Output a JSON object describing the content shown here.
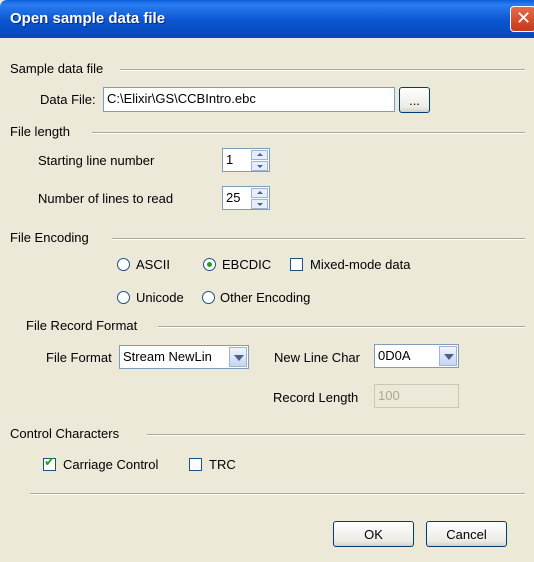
{
  "window": {
    "title": "Open sample data file",
    "close_glyph": "✕"
  },
  "sample_data": {
    "section_label": "Sample data file",
    "data_file_label": "Data File:",
    "data_file_value": "C:\\Elixir\\GS\\CCBIntro.ebc",
    "browse_label": "..."
  },
  "file_length": {
    "section_label": "File length",
    "start_label": "Starting line number",
    "start_value": "1",
    "lines_label": "Number of lines to read",
    "lines_value": "25"
  },
  "encoding": {
    "section_label": "File Encoding",
    "ascii": "ASCII",
    "ebcdic": "EBCDIC",
    "mixed": "Mixed-mode data",
    "unicode": "Unicode",
    "other": "Other Encoding",
    "selected": "EBCDIC",
    "mixed_checked": false
  },
  "record_format": {
    "section_label": "File Record Format",
    "file_format_label": "File Format",
    "file_format_value": "Stream NewLin",
    "new_line_label": "New Line Char",
    "new_line_value": "0D0A",
    "record_length_label": "Record Length",
    "record_length_value": "100"
  },
  "control_chars": {
    "section_label": "Control Characters",
    "carriage_label": "Carriage Control",
    "carriage_checked": true,
    "trc_label": "TRC",
    "trc_checked": false
  },
  "buttons": {
    "ok": "OK",
    "cancel": "Cancel"
  },
  "colors": {
    "title_bar": "#0a56d0",
    "dialog_bg": "#ece9d8",
    "check_green": "#21a121"
  }
}
